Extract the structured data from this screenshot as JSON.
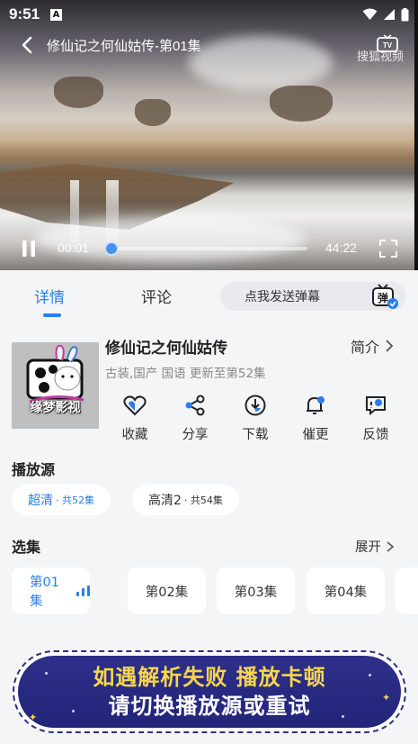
{
  "status_bar": {
    "time": "9:51",
    "notification_badge": "A"
  },
  "player": {
    "title": "修仙记之何仙姑传-第01集",
    "watermark": "搜狐视频",
    "current_time": "00:01",
    "total_time": "44:22",
    "progress_fraction": 0.001
  },
  "tabs": {
    "details": "详情",
    "comments": "评论",
    "danmu_placeholder": "点我发送弹幕",
    "danmu_icon_label": "弹"
  },
  "show": {
    "poster_brand": "缘梦影视",
    "title": "修仙记之何仙姑传",
    "intro_label": "简介",
    "meta": "古装,国产 国语 更新至第52集"
  },
  "actions": [
    {
      "label": "收藏",
      "icon": "heart-icon"
    },
    {
      "label": "分享",
      "icon": "share-icon"
    },
    {
      "label": "下载",
      "icon": "download-icon"
    },
    {
      "label": "催更",
      "icon": "bell-icon"
    },
    {
      "label": "反馈",
      "icon": "feedback-icon"
    }
  ],
  "sources": {
    "section_title": "播放源",
    "items": [
      {
        "name": "超清",
        "count": "· 共52集"
      },
      {
        "name": "高清2",
        "count": "· 共54集"
      }
    ]
  },
  "episodes": {
    "section_title": "选集",
    "expand_label": "展开",
    "items": [
      "第01集",
      "第02集",
      "第03集",
      "第04集"
    ]
  },
  "banner": {
    "line1": "如遇解析失败 播放卡顿",
    "line2": "请切换播放源或重试"
  },
  "colors": {
    "accent": "#2a7df0",
    "banner_bg": "#2d2f8a",
    "banner_yellow": "#f7d64a"
  }
}
